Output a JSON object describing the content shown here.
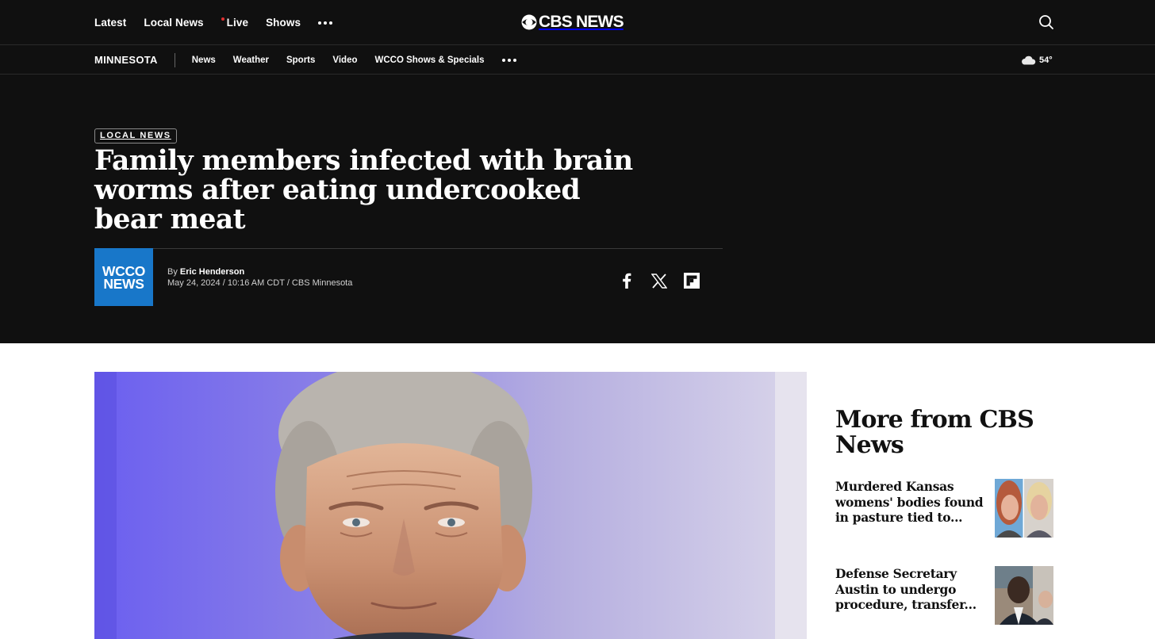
{
  "topnav": {
    "items": [
      "Latest",
      "Local News",
      "Live",
      "Shows"
    ],
    "logo": "CBS NEWS"
  },
  "subnav": {
    "region": "MINNESOTA",
    "items": [
      "News",
      "Weather",
      "Sports",
      "Video",
      "WCCO Shows & Specials"
    ],
    "weather": {
      "icon": "cloud-icon",
      "temp": "54°"
    }
  },
  "article": {
    "category": "LOCAL NEWS",
    "headline": "Family members infected with brain worms after eating undercooked bear meat",
    "station_logo": [
      "WCCO",
      "NEWS"
    ],
    "byline_prefix": "By ",
    "author": "Eric Henderson",
    "dateline": "May 24, 2024 / 10:16 AM CDT / CBS Minnesota",
    "share_icons": [
      "facebook-icon",
      "x-icon",
      "flipboard-icon"
    ]
  },
  "sidebar": {
    "title": "More from CBS News",
    "stories": [
      {
        "title": "Murdered Kansas womens' bodies found in pasture tied to..."
      },
      {
        "title": "Defense Secretary Austin to undergo procedure, transfer..."
      }
    ]
  },
  "colors": {
    "header_bg": "#101010",
    "live_dot": "#e03030",
    "wcco_blue": "#1877c9"
  }
}
